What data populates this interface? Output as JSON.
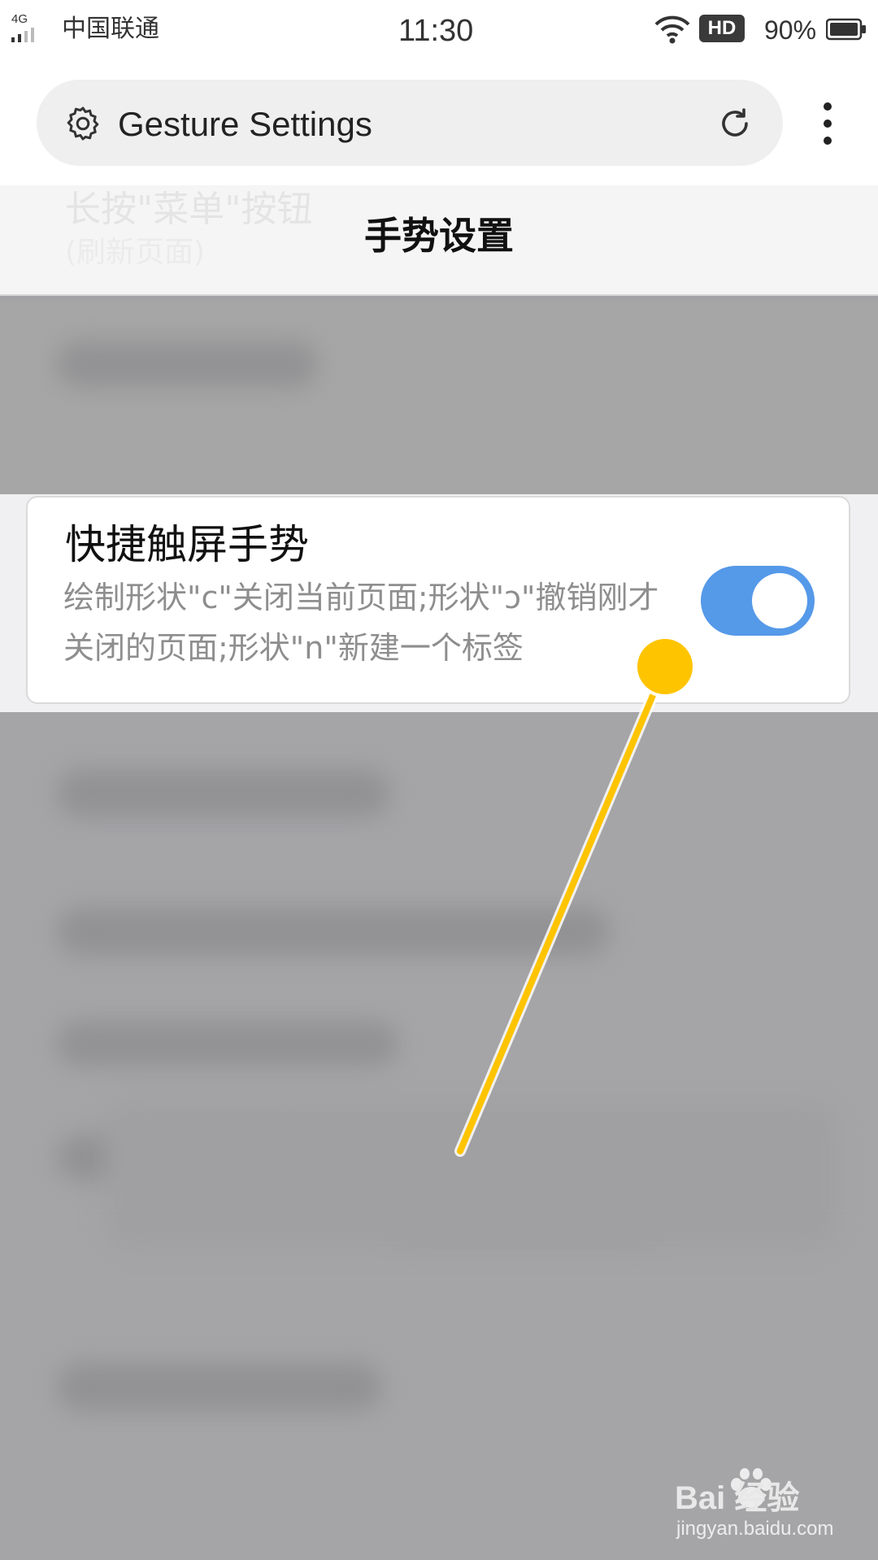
{
  "status_bar": {
    "network": "4G",
    "carrier": "中国联通",
    "time": "11:30",
    "hd_badge": "HD",
    "battery": "90%"
  },
  "top_bar": {
    "url_title": "Gesture Settings",
    "icons": [
      "gear-icon",
      "refresh-icon",
      "more-vert-icon"
    ]
  },
  "header": {
    "title": "手势设置",
    "ghost_line1": "长按\"菜单\"按钮",
    "ghost_line2": "(刷新页面)"
  },
  "setting_card": {
    "title": "快捷触屏手势",
    "description": "绘制形状\"c\"关闭当前页面;形状\"ɔ\"撤销刚才关闭的页面;形状\"n\"新建一个标签",
    "toggle_on": true,
    "toggle_color": "#5599e9"
  },
  "annotation": {
    "color": "#ffc400"
  },
  "watermark": {
    "logo": "Bai 经验",
    "url": "jingyan.baidu.com"
  }
}
